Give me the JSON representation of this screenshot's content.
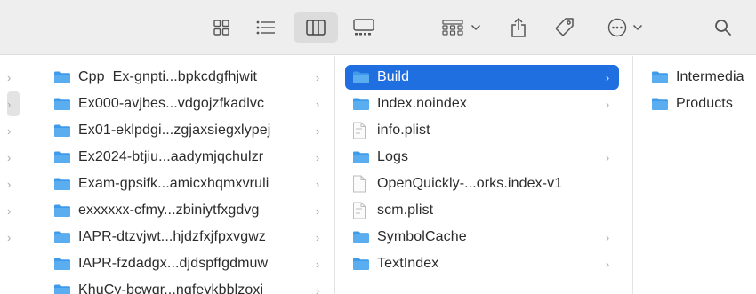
{
  "toolbar": {
    "icons": [
      "grid-view-icon",
      "list-view-icon",
      "column-view-icon",
      "gallery-view-icon",
      "group-icon",
      "share-icon",
      "tag-icon",
      "more-icon",
      "search-icon"
    ]
  },
  "column1": {
    "items": [
      {
        "label": "Cpp_Ex-gnpti...bpkcdgfhjwit",
        "icon": "folder-icon"
      },
      {
        "label": "Ex000-avjbes...vdgojzfkadlvc",
        "icon": "folder-icon"
      },
      {
        "label": "Ex01-eklpdgi...zgjaxsiegxlypej",
        "icon": "folder-icon"
      },
      {
        "label": "Ex2024-btjiu...aadymjqchulzr",
        "icon": "folder-icon"
      },
      {
        "label": "Exam-gpsifk...amicxhqmxvruli",
        "icon": "folder-icon"
      },
      {
        "label": "exxxxxx-cfmy...zbiniytfxgdvg",
        "icon": "folder-icon"
      },
      {
        "label": "IAPR-dtzvjwt...hjdzfxjfpxvgwz",
        "icon": "folder-icon"
      },
      {
        "label": "IAPR-fzdadgx...djdspffgdmuw",
        "icon": "folder-icon"
      },
      {
        "label": "KhuCy-bcwgr...ngfeykbblzoxi",
        "icon": "folder-icon"
      }
    ]
  },
  "column2": {
    "items": [
      {
        "label": "Build",
        "icon": "folder-icon",
        "selected": true,
        "chevron": true
      },
      {
        "label": "Index.noindex",
        "icon": "folder-icon",
        "chevron": true
      },
      {
        "label": "info.plist",
        "icon": "document-icon",
        "chevron": false
      },
      {
        "label": "Logs",
        "icon": "folder-icon",
        "chevron": true
      },
      {
        "label": "OpenQuickly-...orks.index-v1",
        "icon": "blank-file-icon",
        "chevron": false
      },
      {
        "label": "scm.plist",
        "icon": "document-icon",
        "chevron": false
      },
      {
        "label": "SymbolCache",
        "icon": "folder-icon",
        "chevron": true
      },
      {
        "label": "TextIndex",
        "icon": "folder-icon",
        "chevron": true
      }
    ]
  },
  "column3": {
    "items": [
      {
        "label": "Intermedia",
        "icon": "folder-icon"
      },
      {
        "label": "Products",
        "icon": "folder-icon"
      }
    ]
  },
  "colors": {
    "folder": "#3d9be9",
    "selection": "#1f6fe0",
    "toolbar_bg": "#efeeee"
  }
}
